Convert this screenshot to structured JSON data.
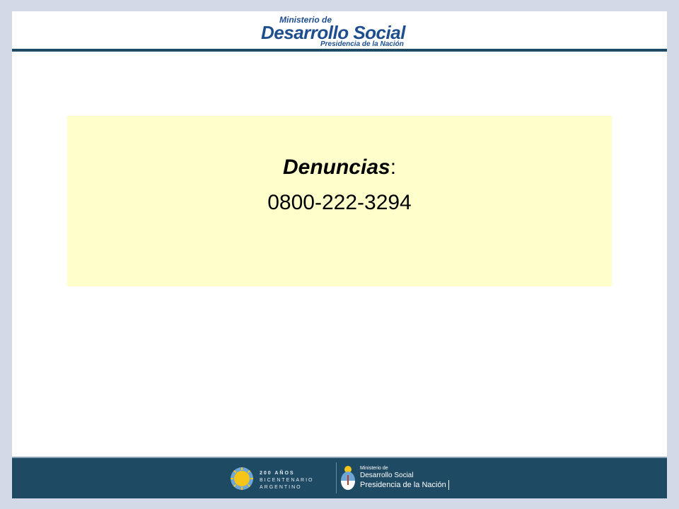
{
  "header": {
    "logo_line1": "Ministerio de",
    "logo_line2": "Desarrollo Social",
    "logo_line3": "Presidencia de la Nación"
  },
  "main": {
    "label": "Denuncias",
    "label_suffix": ":",
    "phone": "0800-222-3294"
  },
  "footer": {
    "bicentenario": [
      "200 AÑOS",
      "BICENTENARIO",
      "ARGENTINO"
    ],
    "ministerio_line1": "Ministerio de",
    "ministerio_line2": "Desarrollo Social",
    "ministerio_line3": "Presidencia de la Nación"
  },
  "colors": {
    "background": "#d3d9e6",
    "footer_bar": "#1f4a63",
    "highlight_box": "#ffffcc",
    "logo_blue": "#1f4e8f"
  }
}
